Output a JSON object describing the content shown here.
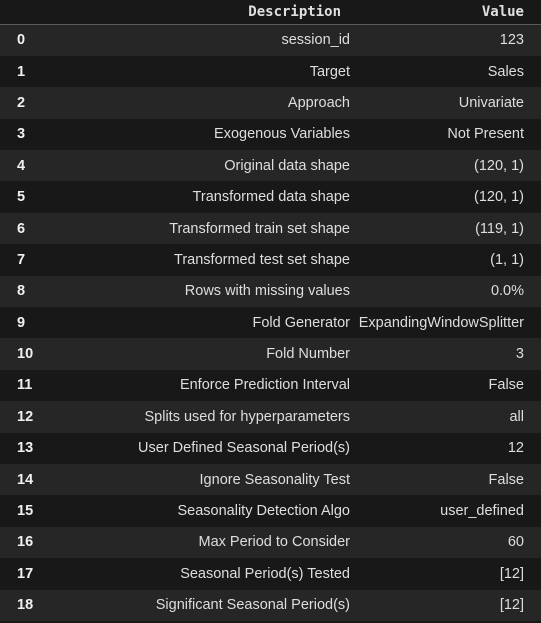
{
  "header": {
    "description": "Description",
    "value": "Value"
  },
  "rows": [
    {
      "index": "0",
      "description": "session_id",
      "value": "123"
    },
    {
      "index": "1",
      "description": "Target",
      "value": "Sales"
    },
    {
      "index": "2",
      "description": "Approach",
      "value": "Univariate"
    },
    {
      "index": "3",
      "description": "Exogenous Variables",
      "value": "Not Present"
    },
    {
      "index": "4",
      "description": "Original data shape",
      "value": "(120, 1)"
    },
    {
      "index": "5",
      "description": "Transformed data shape",
      "value": "(120, 1)"
    },
    {
      "index": "6",
      "description": "Transformed train set shape",
      "value": "(119, 1)"
    },
    {
      "index": "7",
      "description": "Transformed test set shape",
      "value": "(1, 1)"
    },
    {
      "index": "8",
      "description": "Rows with missing values",
      "value": "0.0%"
    },
    {
      "index": "9",
      "description": "Fold Generator",
      "value": "ExpandingWindowSplitter"
    },
    {
      "index": "10",
      "description": "Fold Number",
      "value": "3"
    },
    {
      "index": "11",
      "description": "Enforce Prediction Interval",
      "value": "False"
    },
    {
      "index": "12",
      "description": "Splits used for hyperparameters",
      "value": "all"
    },
    {
      "index": "13",
      "description": "User Defined Seasonal Period(s)",
      "value": "12"
    },
    {
      "index": "14",
      "description": "Ignore Seasonality Test",
      "value": "False"
    },
    {
      "index": "15",
      "description": "Seasonality Detection Algo",
      "value": "user_defined"
    },
    {
      "index": "16",
      "description": "Max Period to Consider",
      "value": "60"
    },
    {
      "index": "17",
      "description": "Seasonal Period(s) Tested",
      "value": "[12]"
    },
    {
      "index": "18",
      "description": "Significant Seasonal Period(s)",
      "value": "[12]"
    }
  ]
}
